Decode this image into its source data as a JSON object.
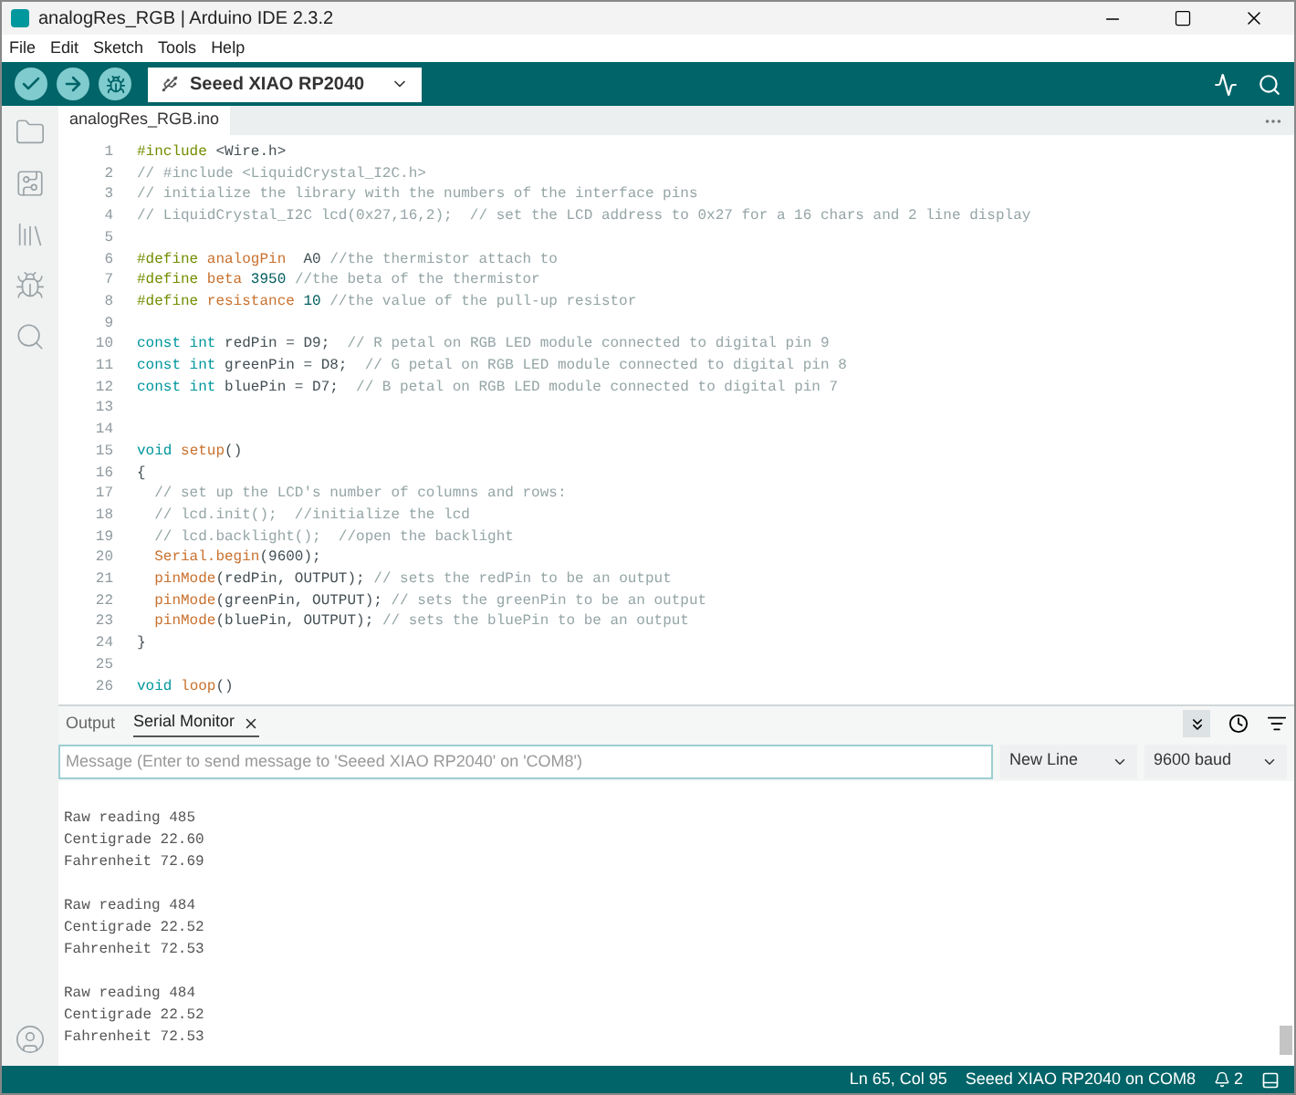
{
  "window": {
    "title": "analogRes_RGB | Arduino IDE 2.3.2"
  },
  "menu": [
    "File",
    "Edit",
    "Sketch",
    "Tools",
    "Help"
  ],
  "toolbar": {
    "board": "Seeed XIAO RP2040"
  },
  "editor": {
    "tabs": [
      {
        "label": "analogRes_RGB.ino",
        "selected": true
      }
    ],
    "lines": [
      {
        "number": "1",
        "tokens": [
          {
            "text": "#include",
            "kind": "directive"
          },
          {
            "text": " <Wire.h>",
            "kind": "plain"
          }
        ]
      },
      {
        "number": "2",
        "tokens": [
          {
            "text": "// #include <LiquidCrystal_I2C.h>",
            "kind": "comment"
          }
        ]
      },
      {
        "number": "3",
        "tokens": [
          {
            "text": "// initialize the library with the numbers of the interface pins",
            "kind": "comment"
          }
        ]
      },
      {
        "number": "4",
        "tokens": [
          {
            "text": "// LiquidCrystal_I2C lcd(0x27,16,2);  // set the LCD address to 0x27 for a 16 chars and 2 line display",
            "kind": "comment"
          }
        ]
      },
      {
        "number": "5"
      },
      {
        "number": "6",
        "tokens": [
          {
            "text": "#define ",
            "kind": "directive"
          },
          {
            "text": "analogPin",
            "kind": "func"
          },
          {
            "text": "  A0 ",
            "kind": "plain"
          },
          {
            "text": "//the thermistor attach to",
            "kind": "comment"
          }
        ]
      },
      {
        "number": "7",
        "tokens": [
          {
            "text": "#define ",
            "kind": "directive"
          },
          {
            "text": "beta ",
            "kind": "func"
          },
          {
            "text": "3950 ",
            "kind": "number"
          },
          {
            "text": "//the beta of the thermistor",
            "kind": "comment"
          }
        ]
      },
      {
        "number": "8",
        "tokens": [
          {
            "text": "#define ",
            "kind": "directive"
          },
          {
            "text": "resistance ",
            "kind": "func"
          },
          {
            "text": "10 ",
            "kind": "number"
          },
          {
            "text": "//the value of the pull-up resistor",
            "kind": "comment"
          }
        ]
      },
      {
        "number": "9"
      },
      {
        "number": "10",
        "tokens": [
          {
            "text": "const int",
            "kind": "keyword"
          },
          {
            "text": " redPin = D9;  ",
            "kind": "plain"
          },
          {
            "text": "// R petal on RGB LED module connected to digital pin 9",
            "kind": "comment"
          }
        ]
      },
      {
        "number": "11",
        "tokens": [
          {
            "text": "const int",
            "kind": "keyword"
          },
          {
            "text": " greenPin = D8;  ",
            "kind": "plain"
          },
          {
            "text": "// G petal on RGB LED module connected to digital pin 8",
            "kind": "comment"
          }
        ]
      },
      {
        "number": "12",
        "tokens": [
          {
            "text": "const int",
            "kind": "keyword"
          },
          {
            "text": " bluePin = D7;  ",
            "kind": "plain"
          },
          {
            "text": "// B petal on RGB LED module connected to digital pin 7",
            "kind": "comment"
          }
        ]
      },
      {
        "number": "13"
      },
      {
        "number": "14"
      },
      {
        "number": "15",
        "tokens": [
          {
            "text": "void ",
            "kind": "keyword"
          },
          {
            "text": "setup",
            "kind": "func"
          },
          {
            "text": "()",
            "kind": "plain"
          }
        ]
      },
      {
        "number": "16",
        "tokens": [
          {
            "text": "{",
            "kind": "plain"
          }
        ]
      },
      {
        "number": "17",
        "tokens": [
          {
            "text": "  // set up the LCD's number of columns and rows:",
            "kind": "comment"
          }
        ]
      },
      {
        "number": "18",
        "tokens": [
          {
            "text": "  // lcd.init();  //initialize the lcd",
            "kind": "comment"
          }
        ]
      },
      {
        "number": "19",
        "tokens": [
          {
            "text": "  // lcd.backlight();  //open the backlight",
            "kind": "comment"
          }
        ]
      },
      {
        "number": "20",
        "tokens": [
          {
            "text": "  Serial.begin",
            "kind": "func"
          },
          {
            "text": "(9600);",
            "kind": "plain"
          }
        ]
      },
      {
        "number": "21",
        "tokens": [
          {
            "text": "  pinMode",
            "kind": "func"
          },
          {
            "text": "(redPin, OUTPUT); ",
            "kind": "plain"
          },
          {
            "text": "// sets the redPin to be an output",
            "kind": "comment"
          }
        ]
      },
      {
        "number": "22",
        "tokens": [
          {
            "text": "  pinMode",
            "kind": "func"
          },
          {
            "text": "(greenPin, OUTPUT); ",
            "kind": "plain"
          },
          {
            "text": "// sets the greenPin to be an output",
            "kind": "comment"
          }
        ]
      },
      {
        "number": "23",
        "tokens": [
          {
            "text": "  pinMode",
            "kind": "func"
          },
          {
            "text": "(bluePin, OUTPUT); ",
            "kind": "plain"
          },
          {
            "text": "// sets the bluePin to be an output",
            "kind": "comment"
          }
        ]
      },
      {
        "number": "24",
        "tokens": [
          {
            "text": "}",
            "kind": "plain"
          }
        ]
      },
      {
        "number": "25"
      },
      {
        "number": "26",
        "tokens": [
          {
            "text": "void ",
            "kind": "keyword"
          },
          {
            "text": "loop",
            "kind": "func"
          },
          {
            "text": "()",
            "kind": "plain"
          }
        ]
      }
    ]
  },
  "panel": {
    "tabs": [
      {
        "label": "Output",
        "selected": false
      },
      {
        "label": "Serial Monitor",
        "selected": true
      }
    ],
    "autoscroll": true,
    "message": {
      "placeholder": "Message (Enter to send message to 'Seeed XIAO RP2040' on 'COM8')"
    },
    "line_ending": "New Line",
    "baud": "9600 baud",
    "output": [
      [
        "Raw reading 485",
        "Centigrade 22.60",
        "Fahrenheit 72.69"
      ],
      [
        "Raw reading 484",
        "Centigrade 22.52",
        "Fahrenheit 72.53"
      ],
      [
        "Raw reading 484",
        "Centigrade 22.52",
        "Fahrenheit 72.53"
      ]
    ]
  },
  "status_bar": {
    "position": "Ln 65, Col 95",
    "board": "Seeed XIAO RP2040 on COM8",
    "notifications": "2"
  }
}
